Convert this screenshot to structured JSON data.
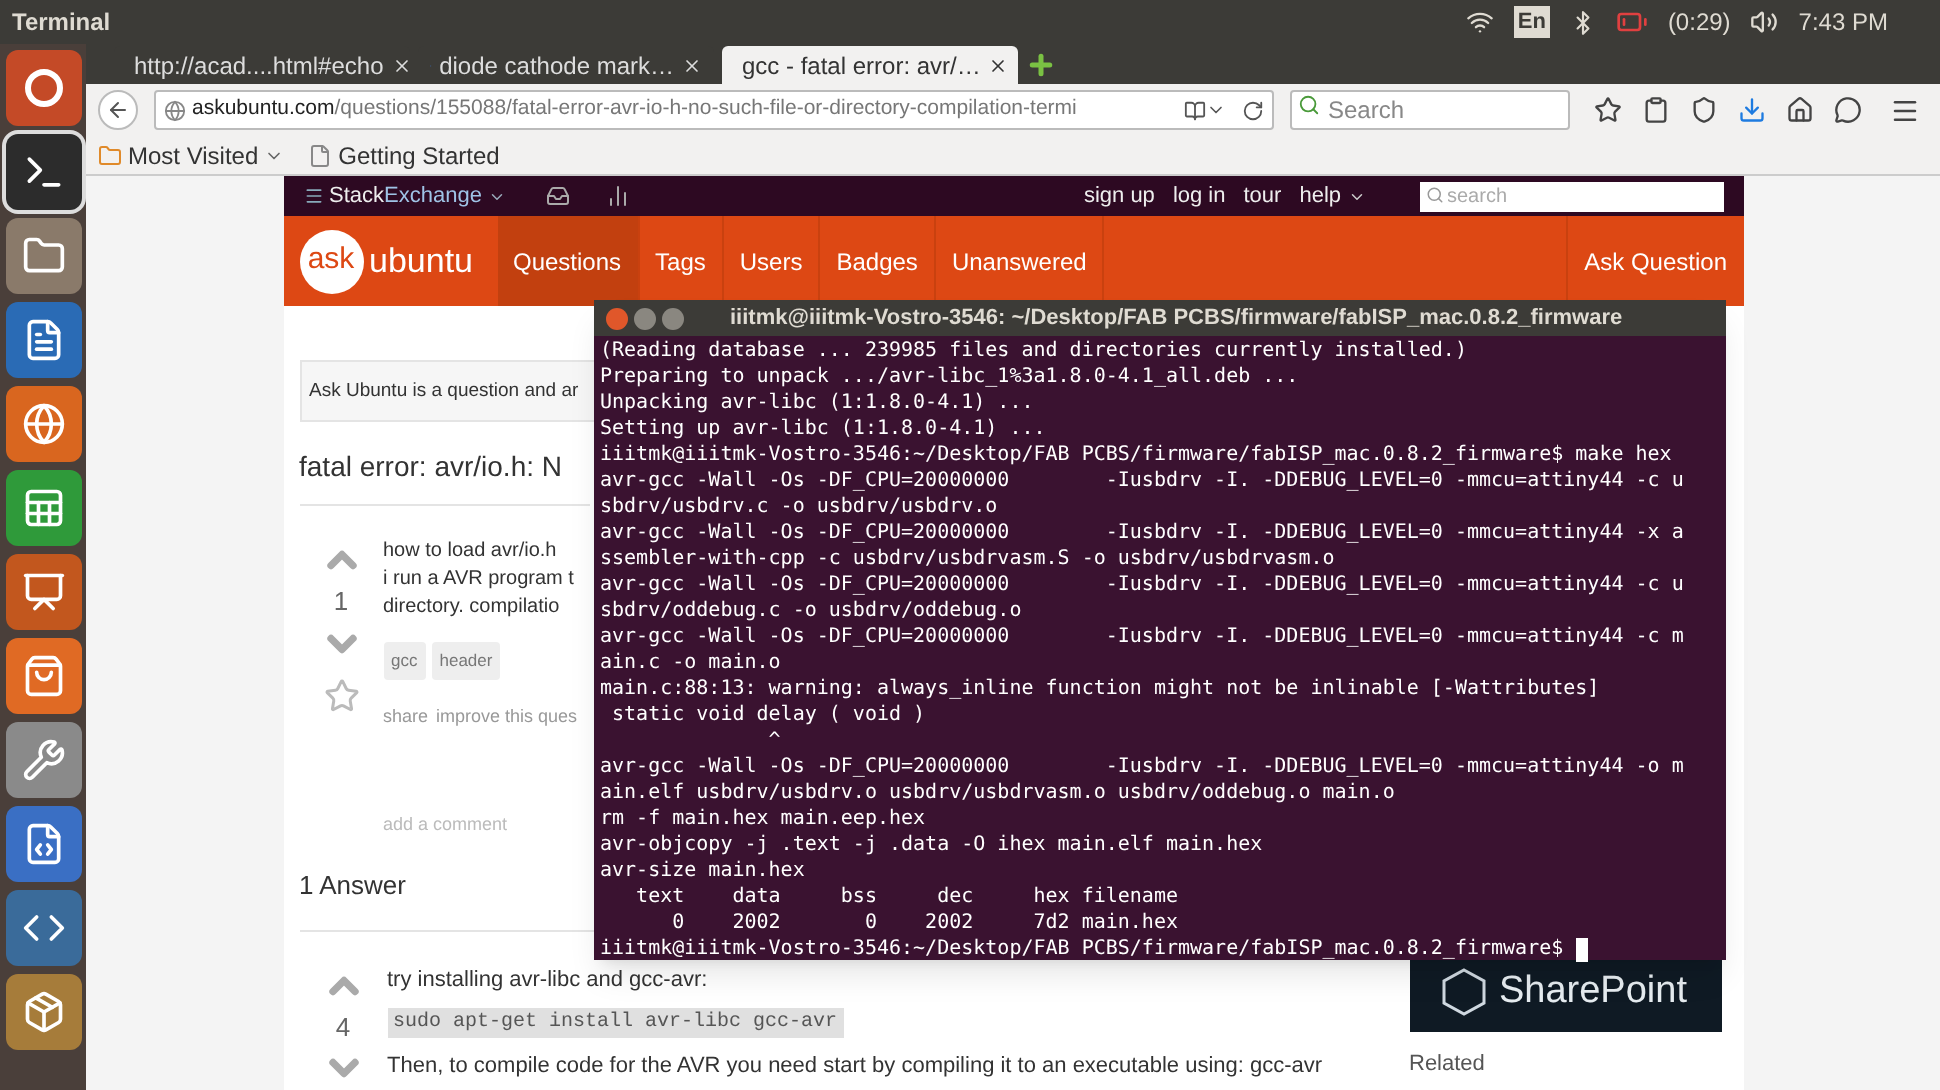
{
  "top_bar": {
    "title": "Terminal",
    "keyboard": "En",
    "battery": "(0:29)",
    "clock": "7:43 PM"
  },
  "launcher": {
    "items": [
      {
        "kind": "ubuntu",
        "selected": false
      },
      {
        "kind": "terminal",
        "selected": true
      },
      {
        "kind": "files",
        "selected": false
      },
      {
        "kind": "writer",
        "selected": false
      },
      {
        "kind": "browser",
        "selected": false
      },
      {
        "kind": "calc",
        "selected": false
      },
      {
        "kind": "impress",
        "selected": false
      },
      {
        "kind": "store",
        "selected": false
      },
      {
        "kind": "settings",
        "selected": false
      },
      {
        "kind": "editor",
        "selected": false
      },
      {
        "kind": "python",
        "selected": false
      },
      {
        "kind": "archive",
        "selected": false
      }
    ]
  },
  "browser": {
    "tabs": [
      {
        "label": "http://acad....html#echo",
        "selected": false
      },
      {
        "label": "diode cathode mark…",
        "selected": false
      },
      {
        "label": "gcc - fatal error: avr/…",
        "selected": true
      }
    ],
    "url_host": "askubuntu.com",
    "url_path": "/questions/155088/fatal-error-avr-io-h-no-such-file-or-directory-compilation-termi",
    "search": {
      "placeholder": "Search"
    },
    "bookmarks": [
      {
        "label": "Most Visited",
        "kind": "folder"
      },
      {
        "label": "Getting Started",
        "kind": "page"
      }
    ]
  },
  "site": {
    "network": "Stack",
    "network_bold": "Exchange",
    "links": [
      "sign up",
      "log in",
      "tour",
      "help"
    ],
    "search": {
      "placeholder": "search"
    },
    "logo_circle": "ask",
    "logo_word": "ubuntu",
    "nav": [
      {
        "label": "Questions",
        "selected": true
      },
      {
        "label": "Tags",
        "selected": false
      },
      {
        "label": "Users",
        "selected": false
      },
      {
        "label": "Badges",
        "selected": false
      },
      {
        "label": "Unanswered",
        "selected": false
      }
    ],
    "ask_button": "Ask Question",
    "notice": "Ask Ubuntu is a question and ar",
    "question": {
      "title": "fatal error: avr/io.h: N",
      "votes": "1",
      "lines": [
        "how to load avr/io.h",
        "i run a AVR program t",
        "directory. compilatio"
      ],
      "tags": [
        "gcc",
        "header"
      ],
      "actions": [
        "share",
        "improve this ques"
      ],
      "add_comment": "add a comment"
    },
    "answers_heading": "1 Answer",
    "answer": {
      "votes": "4",
      "intro": "try installing avr-libc and gcc-avr:",
      "code": "sudo apt-get install avr-libc gcc-avr",
      "text": "Then, to compile code for the AVR you need start by compiling it to an executable using: gcc-avr"
    },
    "ad_brand": "SharePoint",
    "related": "Related"
  },
  "terminal": {
    "title": "iiitmk@iiitmk-Vostro-3546: ~/Desktop/FAB PCBS/firmware/fabISP_mac.0.8.2_firmware",
    "lines": [
      "(Reading database ... 239985 files and directories currently installed.)",
      "Preparing to unpack .../avr-libc_1%3a1.8.0-4.1_all.deb ...",
      "Unpacking avr-libc (1:1.8.0-4.1) ...",
      "Setting up avr-libc (1:1.8.0-4.1) ...",
      "iiitmk@iiitmk-Vostro-3546:~/Desktop/FAB PCBS/firmware/fabISP_mac.0.8.2_firmware$ make hex",
      "avr-gcc -Wall -Os -DF_CPU=20000000        -Iusbdrv -I. -DDEBUG_LEVEL=0 -mmcu=attiny44 -c u",
      "sbdrv/usbdrv.c -o usbdrv/usbdrv.o",
      "avr-gcc -Wall -Os -DF_CPU=20000000        -Iusbdrv -I. -DDEBUG_LEVEL=0 -mmcu=attiny44 -x a",
      "ssembler-with-cpp -c usbdrv/usbdrvasm.S -o usbdrv/usbdrvasm.o",
      "avr-gcc -Wall -Os -DF_CPU=20000000        -Iusbdrv -I. -DDEBUG_LEVEL=0 -mmcu=attiny44 -c u",
      "sbdrv/oddebug.c -o usbdrv/oddebug.o",
      "avr-gcc -Wall -Os -DF_CPU=20000000        -Iusbdrv -I. -DDEBUG_LEVEL=0 -mmcu=attiny44 -c m",
      "ain.c -o main.o",
      "main.c:88:13: warning: always_inline function might not be inlinable [-Wattributes]",
      " static void delay ( void )",
      "              ^",
      "avr-gcc -Wall -Os -DF_CPU=20000000        -Iusbdrv -I. -DDEBUG_LEVEL=0 -mmcu=attiny44 -o m",
      "ain.elf usbdrv/usbdrv.o usbdrv/usbdrvasm.o usbdrv/oddebug.o main.o",
      "rm -f main.hex main.eep.hex",
      "avr-objcopy -j .text -j .data -O ihex main.elf main.hex",
      "avr-size main.hex",
      "   text    data     bss     dec     hex filename",
      "      0    2002       0    2002     7d2 main.hex"
    ],
    "prompt": "iiitmk@iiitmk-Vostro-3546:~/Desktop/FAB PCBS/firmware/fabISP_mac.0.8.2_firmware$ "
  }
}
